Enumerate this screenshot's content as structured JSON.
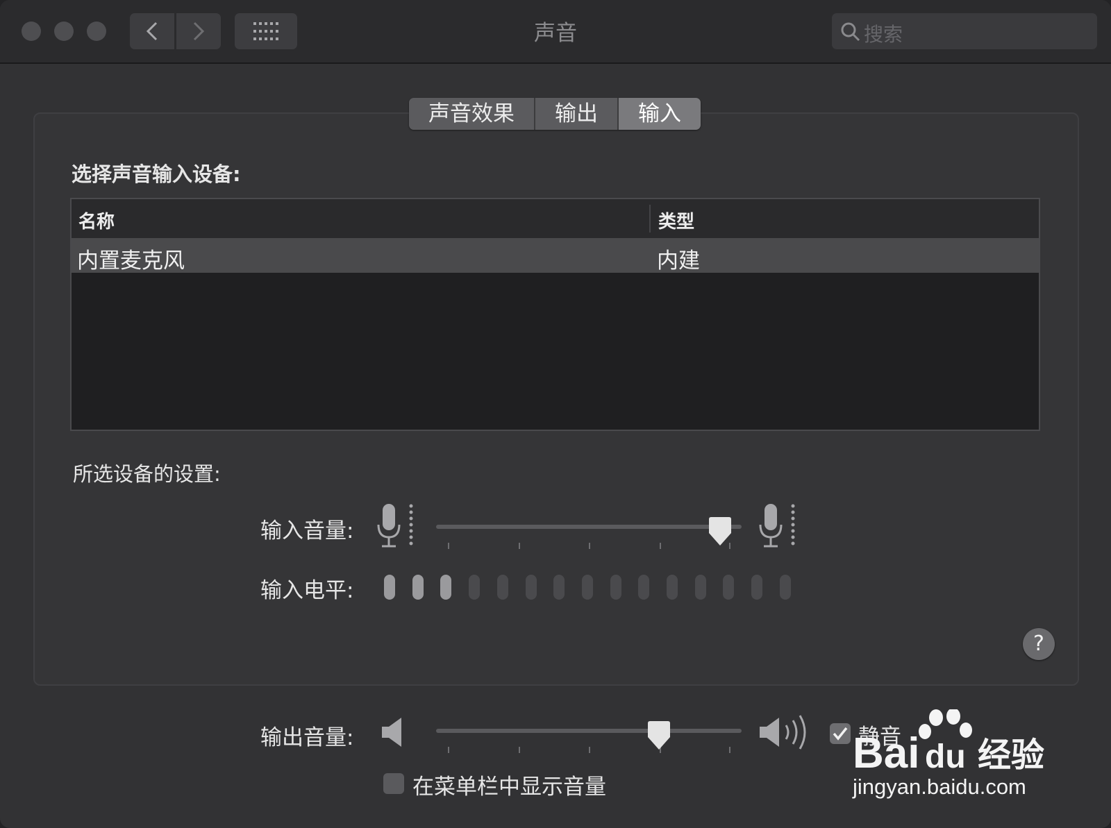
{
  "window": {
    "title": "声音"
  },
  "search": {
    "placeholder": "搜索"
  },
  "tabs": [
    {
      "label": "声音效果",
      "active": false
    },
    {
      "label": "输出",
      "active": false
    },
    {
      "label": "输入",
      "active": true
    }
  ],
  "input_section": {
    "heading": "选择声音输入设备:",
    "columns": {
      "name": "名称",
      "type": "类型"
    },
    "devices": [
      {
        "name": "内置麦克风",
        "type": "内建",
        "selected": true
      }
    ]
  },
  "settings": {
    "heading": "所选设备的设置:",
    "input_volume_label": "输入音量:",
    "input_volume_value": 0.93,
    "input_level_label": "输入电平:",
    "input_level_segments": 15,
    "input_level_active": 3
  },
  "output": {
    "volume_label": "输出音量:",
    "volume_value": 0.73,
    "mute_label": "静音",
    "mute_checked": true,
    "show_in_menubar_label": "在菜单栏中显示音量",
    "show_in_menubar_checked": false
  },
  "help": {
    "label": "?"
  },
  "watermark": {
    "brand": "Bai经验",
    "url": "jingyan.baidu.com"
  },
  "icons": [
    "back-icon",
    "forward-icon",
    "grid-icon",
    "search-icon",
    "microphone-icon",
    "speaker-icon",
    "checkmark-icon"
  ]
}
